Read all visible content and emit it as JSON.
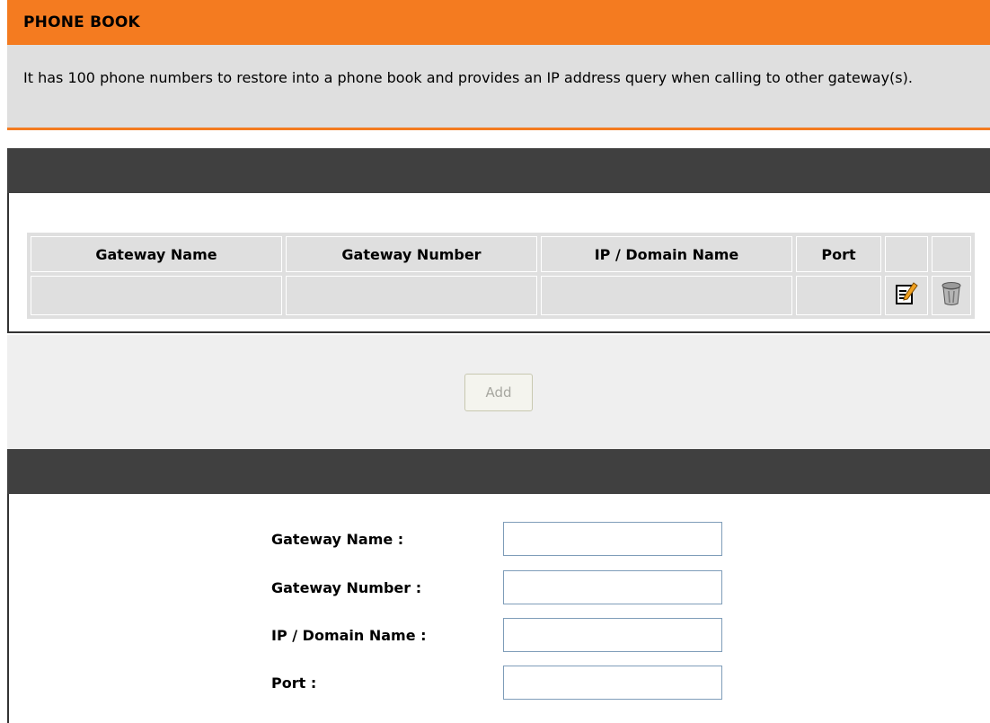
{
  "page": {
    "title": "PHONE BOOK",
    "description": "It has 100 phone numbers to restore into a phone book and provides an IP address query when calling to other gateway(s)."
  },
  "table": {
    "headers": [
      "Gateway Name",
      "Gateway Number",
      "IP / Domain Name",
      "Port",
      "",
      ""
    ],
    "rows": [
      {
        "gateway_name": "",
        "gateway_number": "",
        "ip_domain": "",
        "port": "",
        "edit_icon": "edit-icon",
        "delete_icon": "trash-icon"
      }
    ]
  },
  "buttons": {
    "add_label": "Add"
  },
  "form": {
    "gateway_name": {
      "label": "Gateway Name :",
      "value": ""
    },
    "gateway_number": {
      "label": "Gateway Number :",
      "value": ""
    },
    "ip_domain": {
      "label": "IP / Domain Name :",
      "value": ""
    },
    "port": {
      "label": "Port :",
      "value": ""
    }
  },
  "colors": {
    "accent": "#f47b20",
    "section_bar": "#404040",
    "panel_gray": "#dfdfdf"
  }
}
